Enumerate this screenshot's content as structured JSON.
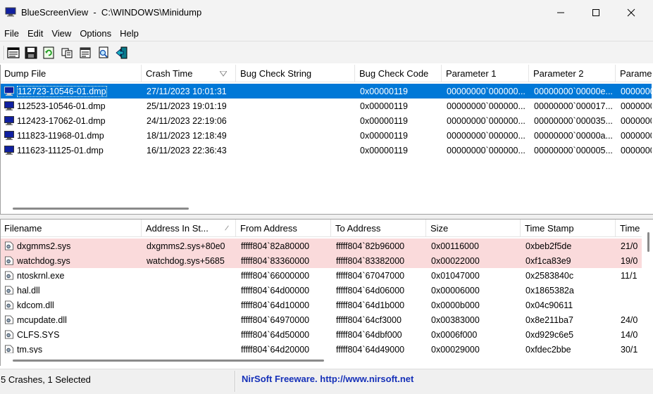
{
  "window": {
    "title": "BlueScreenView  -  C:\\WINDOWS\\Minidump",
    "minimize_icon": "minimize-icon",
    "maximize_icon": "maximize-icon",
    "close_icon": "close-icon"
  },
  "menu": [
    "File",
    "Edit",
    "View",
    "Options",
    "Help"
  ],
  "toolbar": {
    "icons": [
      "html-report-icon",
      "save-icon",
      "refresh-icon",
      "copy-icon",
      "properties-icon",
      "find-icon",
      "exit-icon"
    ]
  },
  "dumps": {
    "columns": [
      "Dump File",
      "Crash Time",
      "Bug Check String",
      "Bug Check Code",
      "Parameter 1",
      "Parameter 2",
      "Parame"
    ],
    "rows": [
      [
        "112723-10546-01.dmp",
        "27/11/2023 10:01:31",
        "",
        "0x00000119",
        "00000000`000000...",
        "00000000`00000e...",
        "0000000"
      ],
      [
        "112523-10546-01.dmp",
        "25/11/2023 19:01:19",
        "",
        "0x00000119",
        "00000000`000000...",
        "00000000`000017...",
        "0000000"
      ],
      [
        "112423-17062-01.dmp",
        "24/11/2023 22:19:06",
        "",
        "0x00000119",
        "00000000`000000...",
        "00000000`000035...",
        "0000000"
      ],
      [
        "111823-11968-01.dmp",
        "18/11/2023 12:18:49",
        "",
        "0x00000119",
        "00000000`000000...",
        "00000000`00000a...",
        "0000000"
      ],
      [
        "111623-11125-01.dmp",
        "16/11/2023 22:36:43",
        "",
        "0x00000119",
        "00000000`000000...",
        "00000000`000005...",
        "0000000"
      ]
    ]
  },
  "modules": {
    "columns": [
      "Filename",
      "Address In St...",
      "From Address",
      "To Address",
      "Size",
      "Time Stamp",
      "Time"
    ],
    "rows": [
      [
        "dxgmms2.sys",
        "dxgmms2.sys+80e0",
        "fffff804`82a80000",
        "fffff804`82b96000",
        "0x00116000",
        "0xbeb2f5de",
        "21/0"
      ],
      [
        "watchdog.sys",
        "watchdog.sys+5685",
        "fffff804`83360000",
        "fffff804`83382000",
        "0x00022000",
        "0xf1ca83e9",
        "19/0"
      ],
      [
        "ntoskrnl.exe",
        "",
        "fffff804`66000000",
        "fffff804`67047000",
        "0x01047000",
        "0x2583840c",
        "11/1"
      ],
      [
        "hal.dll",
        "",
        "fffff804`64d00000",
        "fffff804`64d06000",
        "0x00006000",
        "0x1865382a",
        ""
      ],
      [
        "kdcom.dll",
        "",
        "fffff804`64d10000",
        "fffff804`64d1b000",
        "0x0000b000",
        "0x04c90611",
        ""
      ],
      [
        "mcupdate.dll",
        "",
        "fffff804`64970000",
        "fffff804`64cf3000",
        "0x00383000",
        "0x8e211ba7",
        "24/0"
      ],
      [
        "CLFS.SYS",
        "",
        "fffff804`64d50000",
        "fffff804`64dbf000",
        "0x0006f000",
        "0xd929c6e5",
        "14/0"
      ],
      [
        "tm.sys",
        "",
        "fffff804`64d20000",
        "fffff804`64d49000",
        "0x00029000",
        "0xfdec2bbe",
        "30/1"
      ]
    ]
  },
  "status": {
    "left": "5 Crashes, 1 Selected",
    "right": "NirSoft Freeware.  http://www.nirsoft.net"
  },
  "colors": {
    "selection": "#0078d7",
    "highlight_row": "#fadadb",
    "nirsoft_link": "#1530b8"
  }
}
